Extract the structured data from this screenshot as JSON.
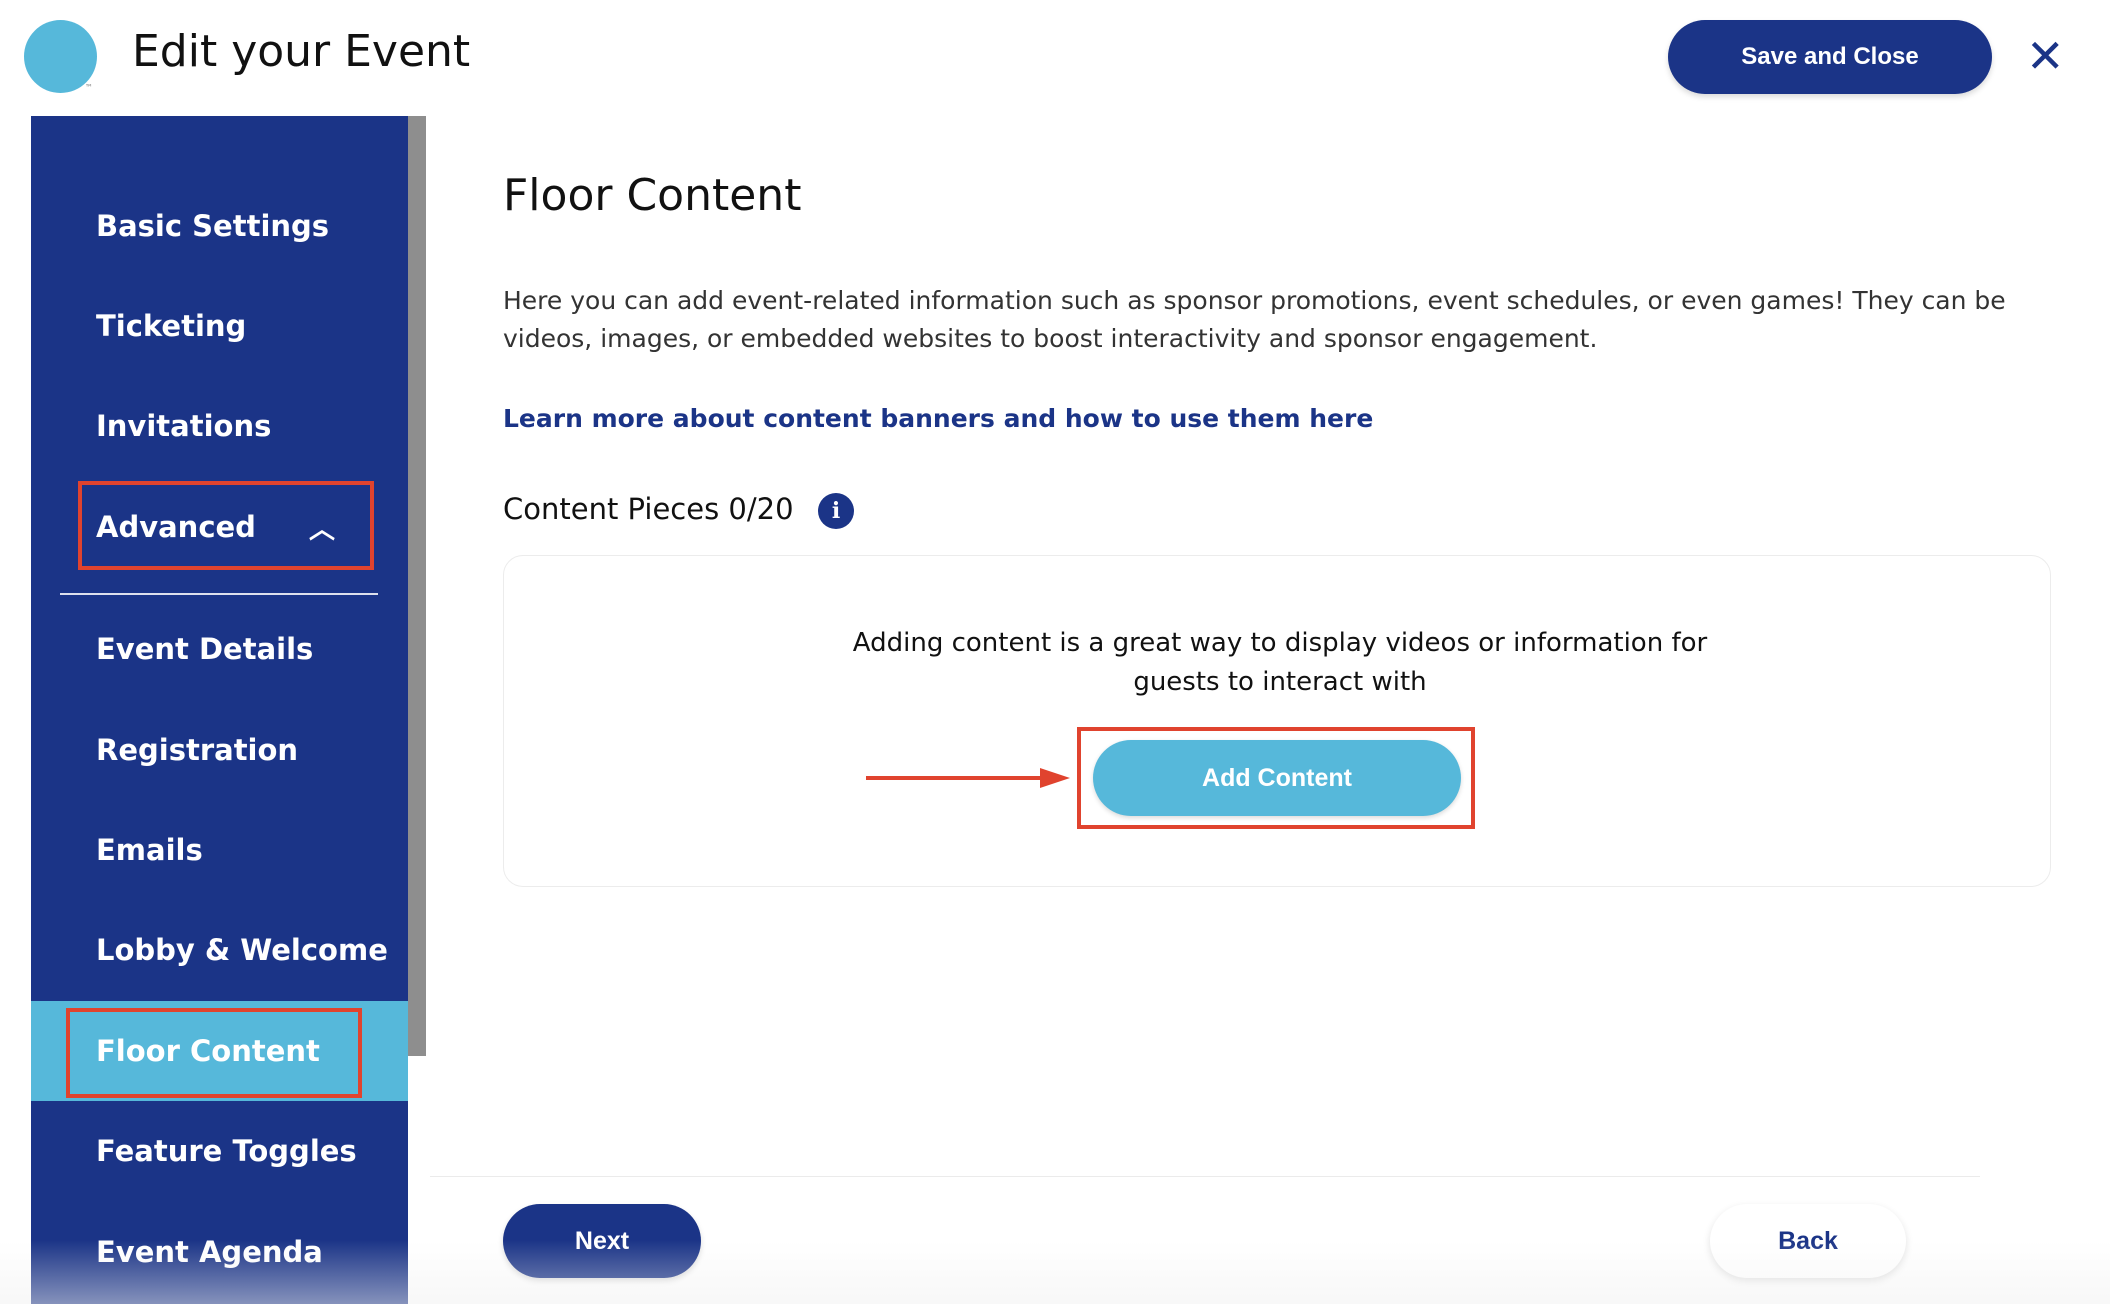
{
  "colors": {
    "primary": "#1b3487",
    "accent": "#56b8da",
    "highlight": "#e0432e"
  },
  "header": {
    "title": "Edit your Event",
    "logo_tm": "™",
    "save_label": "Save and Close",
    "close_icon": "close-icon"
  },
  "sidebar": {
    "items": [
      {
        "label": "Basic Settings"
      },
      {
        "label": "Ticketing"
      },
      {
        "label": "Invitations"
      },
      {
        "label": "Advanced",
        "expanded": true
      },
      {
        "label": "Event Details"
      },
      {
        "label": "Registration"
      },
      {
        "label": "Emails"
      },
      {
        "label": "Lobby & Welcome"
      },
      {
        "label": "Floor Content",
        "active": true
      },
      {
        "label": "Feature Toggles"
      },
      {
        "label": "Event Agenda"
      }
    ]
  },
  "main": {
    "title": "Floor Content",
    "description": "Here you can add event-related information such as sponsor promotions, event schedules, or even games! They can be videos, images, or embedded websites to boost interactivity and sponsor engagement.",
    "learn_more": "Learn more about content banners and how to use them here",
    "pieces_label": "Content Pieces 0/20",
    "pieces_count": 0,
    "pieces_max": 20,
    "info_glyph": "i",
    "card_text": "Adding content is a great way to display videos or information for guests to interact with",
    "add_label": "Add Content"
  },
  "footer": {
    "next_label": "Next",
    "back_label": "Back"
  }
}
